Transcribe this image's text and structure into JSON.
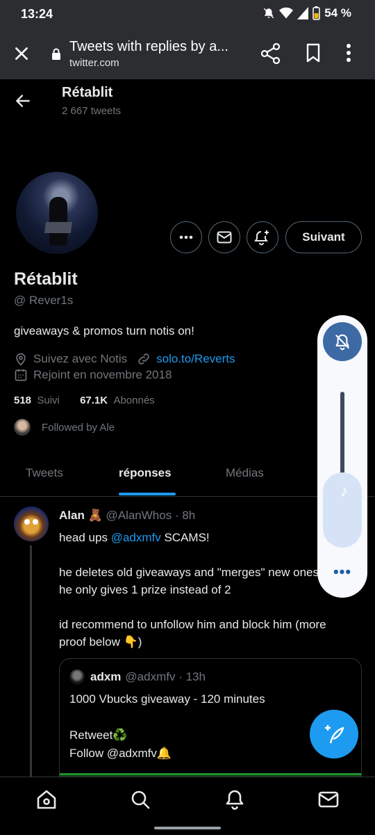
{
  "status_bar": {
    "time": "13:24",
    "battery": "54 %"
  },
  "browser": {
    "title": "Tweets with replies by a...",
    "url": "twitter.com"
  },
  "profile": {
    "header_name": "Rétablit",
    "tweet_count": "2 667 tweets",
    "name": "Rétablit",
    "handle": "@ Rever1s",
    "bio": "giveaways & promos turn notis on!",
    "location": "Suivez avec Notis",
    "link": "solo.to/Reverts",
    "joined": "Rejoint en novembre 2018",
    "following_count": "518",
    "following_label": "Suivi",
    "followers_count": "67.1K",
    "followers_label": "Abonnés",
    "followed_by": "Followed by Ale",
    "follow_button": "Suivant"
  },
  "tabs": [
    {
      "label": "Tweets",
      "active": false
    },
    {
      "label": "réponses",
      "active": true
    },
    {
      "label": "Médias",
      "active": false
    }
  ],
  "tweet": {
    "name": "Alan 🧸",
    "handle": "@AlanWhos",
    "time": "· 8h",
    "line1_pre": "head ups ",
    "line1_mention": "@adxmfv",
    "line1_post": " SCAMS!",
    "line2": "he deletes old giveaways and \"merges\" new ones",
    "line3": "he only gives 1 prize instead of 2",
    "line4": "id recommend to unfollow him and block him (more",
    "line5": "proof below 👇)",
    "quote": {
      "name": "adxm",
      "handle": "@adxmfv",
      "time": "· 13h",
      "line1": "1000 Vbucks giveaway - 120 minutes",
      "line2": "Retweet♻️",
      "line3": "Follow @adxmfv🔔"
    }
  },
  "volume_panel": {
    "more": "•••"
  },
  "colors": {
    "accent": "#1d9bf0",
    "background": "#000000",
    "muted": "#71767b"
  }
}
